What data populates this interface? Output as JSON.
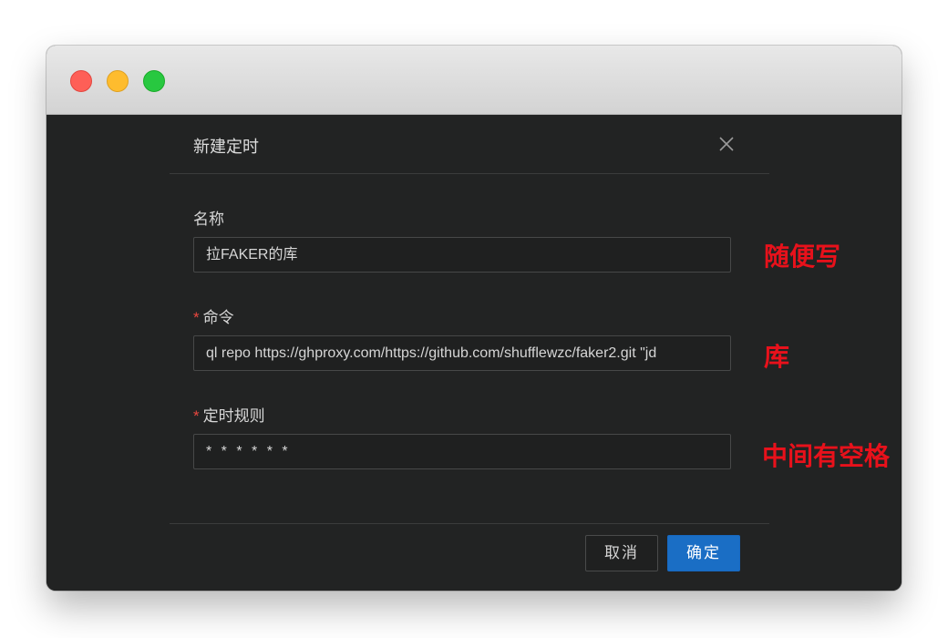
{
  "window": {
    "traffic_lights": [
      "close",
      "minimize",
      "zoom"
    ]
  },
  "dialog": {
    "title": "新建定时",
    "close_icon": "close-icon",
    "fields": {
      "name": {
        "label": "名称",
        "value": "拉FAKER的库",
        "required": false
      },
      "command": {
        "label": "命令",
        "value": "ql repo https://ghproxy.com/https://github.com/shufflewzc/faker2.git \"jd",
        "required": true
      },
      "schedule": {
        "label": "定时规则",
        "value": "* * * * * *",
        "required": true
      }
    },
    "required_mark": "*",
    "buttons": {
      "cancel": "取消",
      "ok": "确定"
    }
  },
  "annotations": {
    "name_note": "随便写",
    "command_note": "库",
    "schedule_note": "中间有空格"
  },
  "colors": {
    "annotation": "#e8111b",
    "primary_button": "#1a6ec5",
    "required_mark": "#e9473f",
    "background": "#222323"
  }
}
